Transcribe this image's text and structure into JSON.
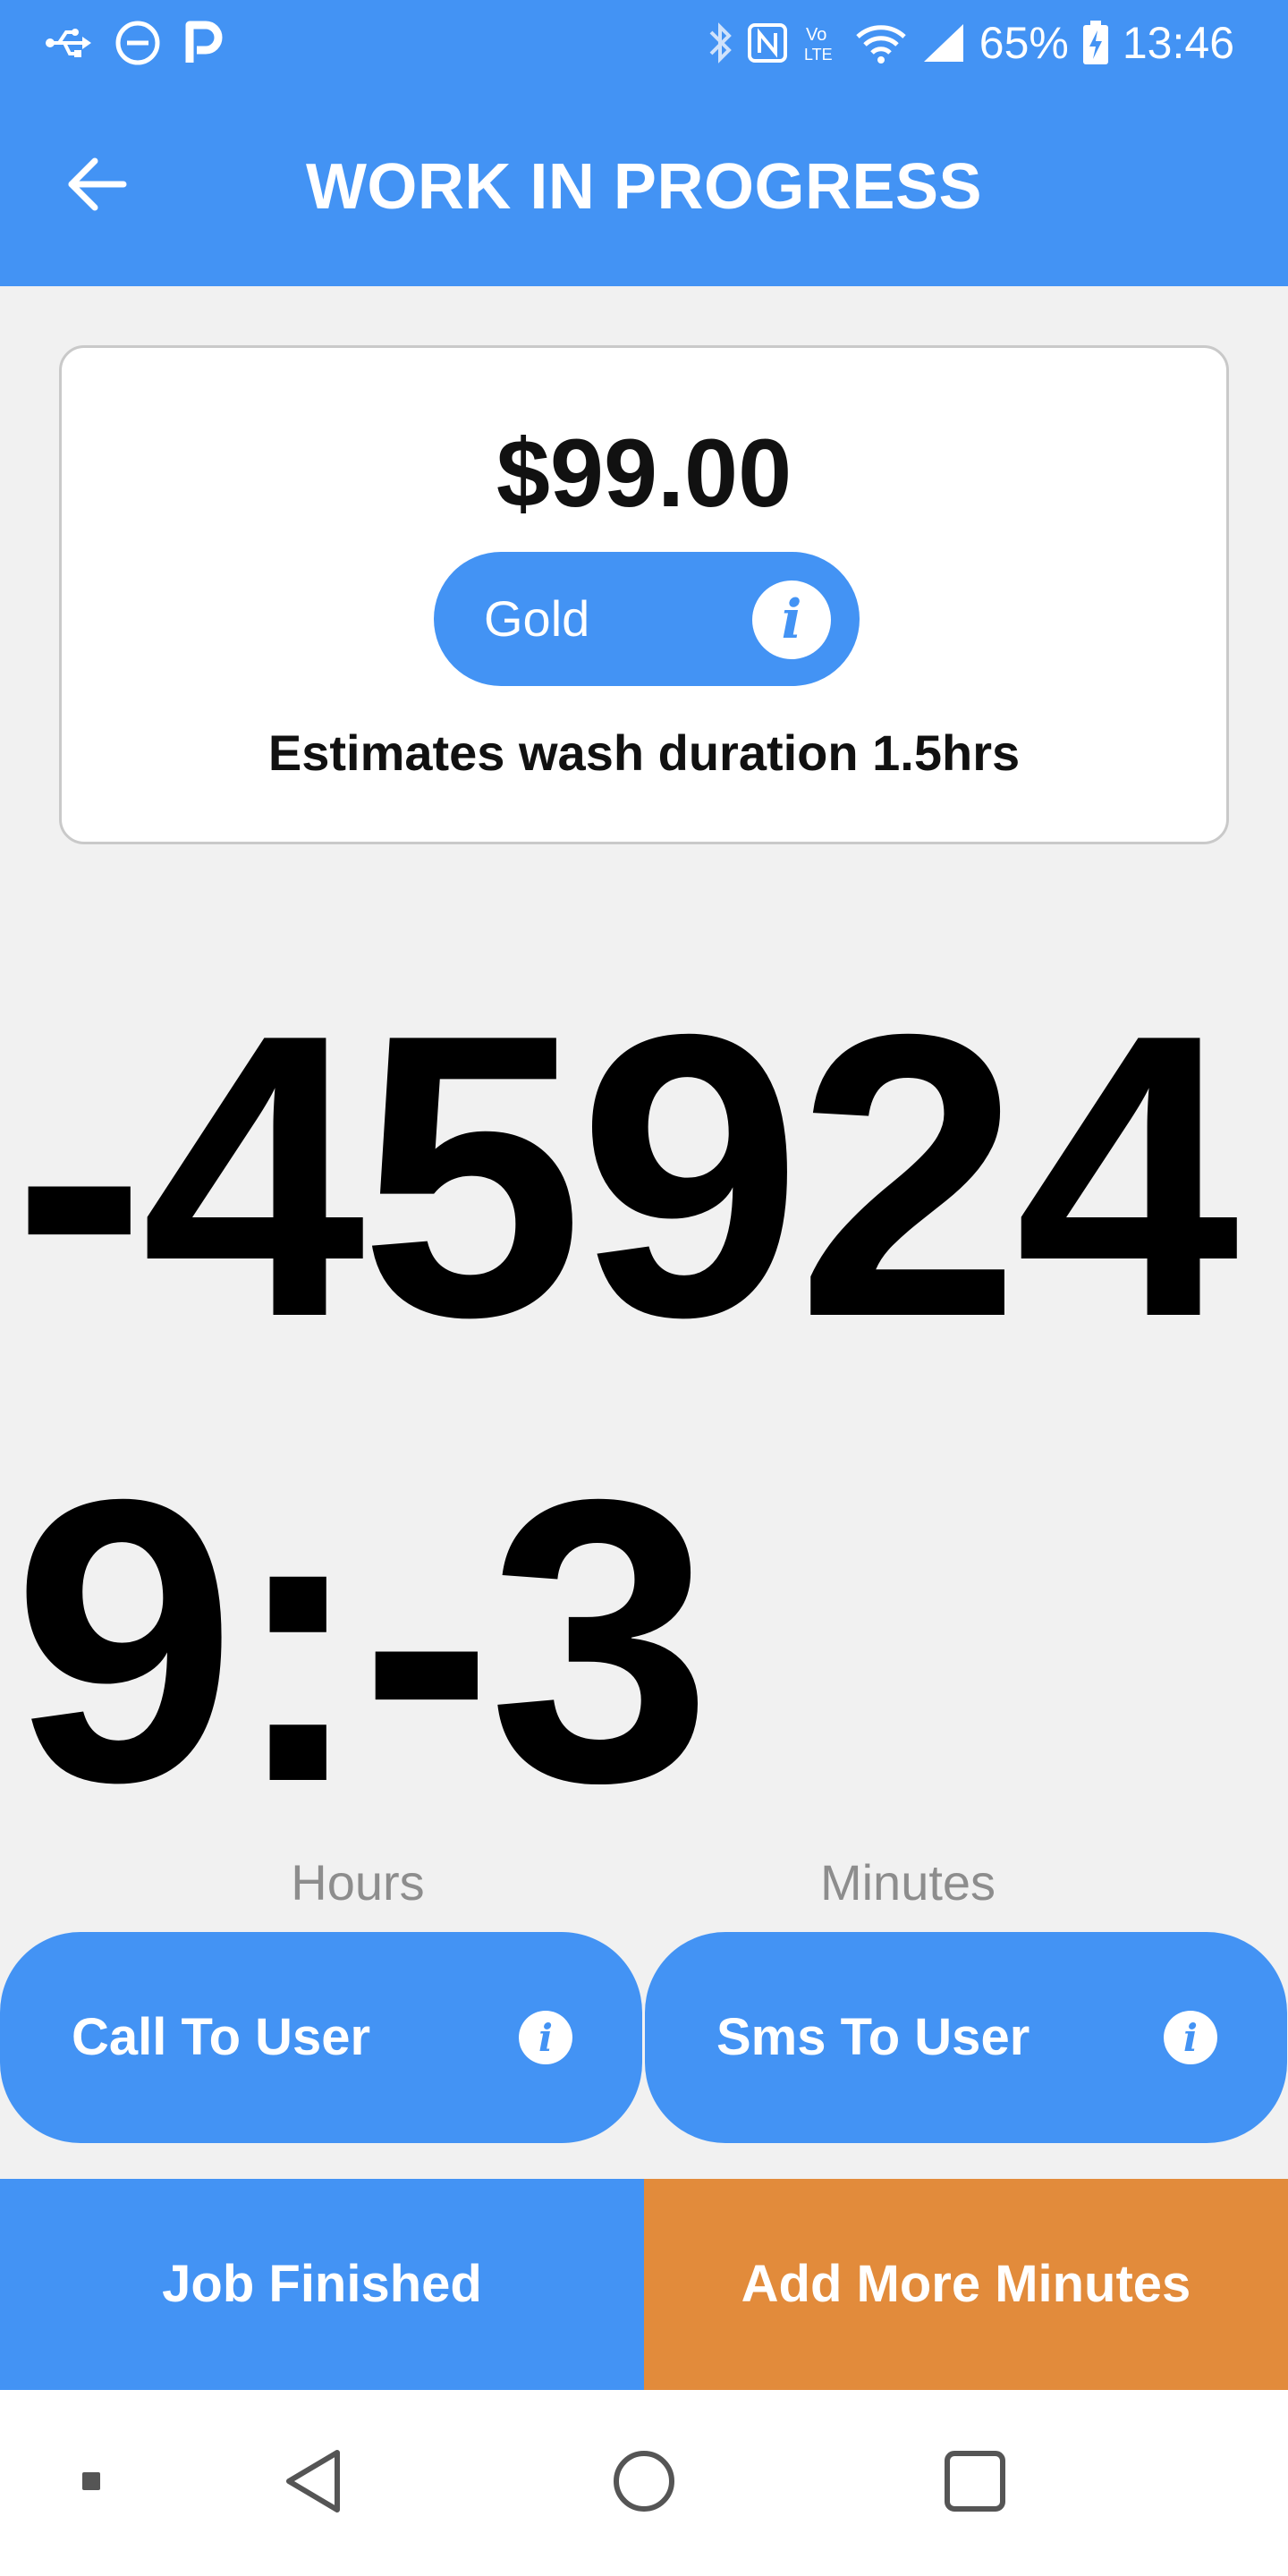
{
  "status_bar": {
    "battery_percent": "65%",
    "time": "13:46",
    "icons_left": [
      "usb-icon",
      "do-not-disturb-icon",
      "parking-app-icon"
    ],
    "icons_right": [
      "bluetooth-icon",
      "nfc-icon",
      "volte-icon",
      "wifi-icon",
      "signal-icon",
      "battery-charging-icon"
    ],
    "volte_text": "Vo LTE"
  },
  "app_bar": {
    "title": "WORK IN PROGRESS",
    "back_icon": "arrow-left-icon"
  },
  "card": {
    "price": "$99.00",
    "plan_name": "Gold",
    "plan_info_icon": "info-icon",
    "duration_text": "Estimates wash duration 1.5hrs"
  },
  "timer": {
    "display": "-459249:-3"
  },
  "labels": {
    "hours": "Hours",
    "minutes": "Minutes"
  },
  "contact_buttons": {
    "call_label": "Call To User",
    "sms_label": "Sms To User"
  },
  "actions": {
    "finish_label": "Job Finished",
    "add_minutes_label": "Add More Minutes"
  },
  "colors": {
    "primary": "#4393f4",
    "accent_orange": "#e28b3b",
    "background": "#f1f1f1",
    "label_gray": "#8d8d8d"
  }
}
